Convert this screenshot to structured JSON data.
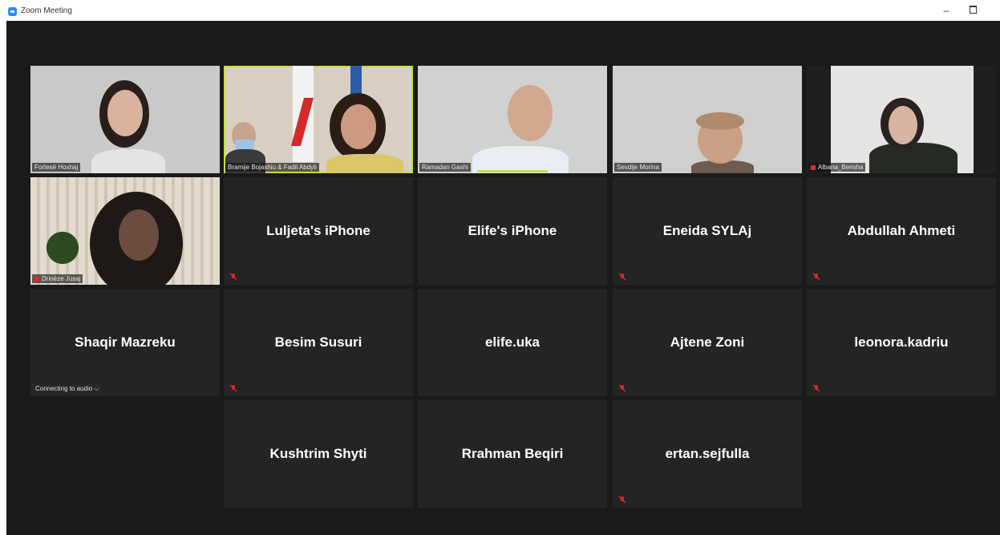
{
  "window": {
    "title": "Zoom Meeting",
    "minimize_label": "–"
  },
  "colors": {
    "active_speaker": "#c7dd3c",
    "mute_icon": "#e02828",
    "tile_bg": "#242424"
  },
  "participants": [
    {
      "name": "Fortesë Hoxhaj",
      "video": true
    },
    {
      "name": "Bramije Bojashiu & Fadil Abdyli",
      "video": true,
      "active": true
    },
    {
      "name": "Ramadan Gashi",
      "video": true
    },
    {
      "name": "Sevdije Morina",
      "video": true
    },
    {
      "name": "Albana_Berisha",
      "video": true,
      "muted": true
    },
    {
      "name": "Drinëze Jusaj",
      "video": true,
      "muted": true
    },
    {
      "name": "Luljeta's iPhone",
      "muted": true
    },
    {
      "name": "Elife's iPhone"
    },
    {
      "name": "Eneida SYLAj",
      "muted": true
    },
    {
      "name": "Abdullah Ahmeti",
      "muted": true
    },
    {
      "name": "Shaqir Mazreku",
      "status": "Connecting to audio ⌵"
    },
    {
      "name": "Besim Susuri",
      "muted": true
    },
    {
      "name": "elife.uka"
    },
    {
      "name": "Ajtene Zoni",
      "muted": true
    },
    {
      "name": "leonora.kadriu",
      "muted": true
    },
    {
      "name": "Kushtrim Shyti"
    },
    {
      "name": "Rrahman Beqiri"
    },
    {
      "name": "ertan.sejfulla",
      "muted": true
    }
  ]
}
